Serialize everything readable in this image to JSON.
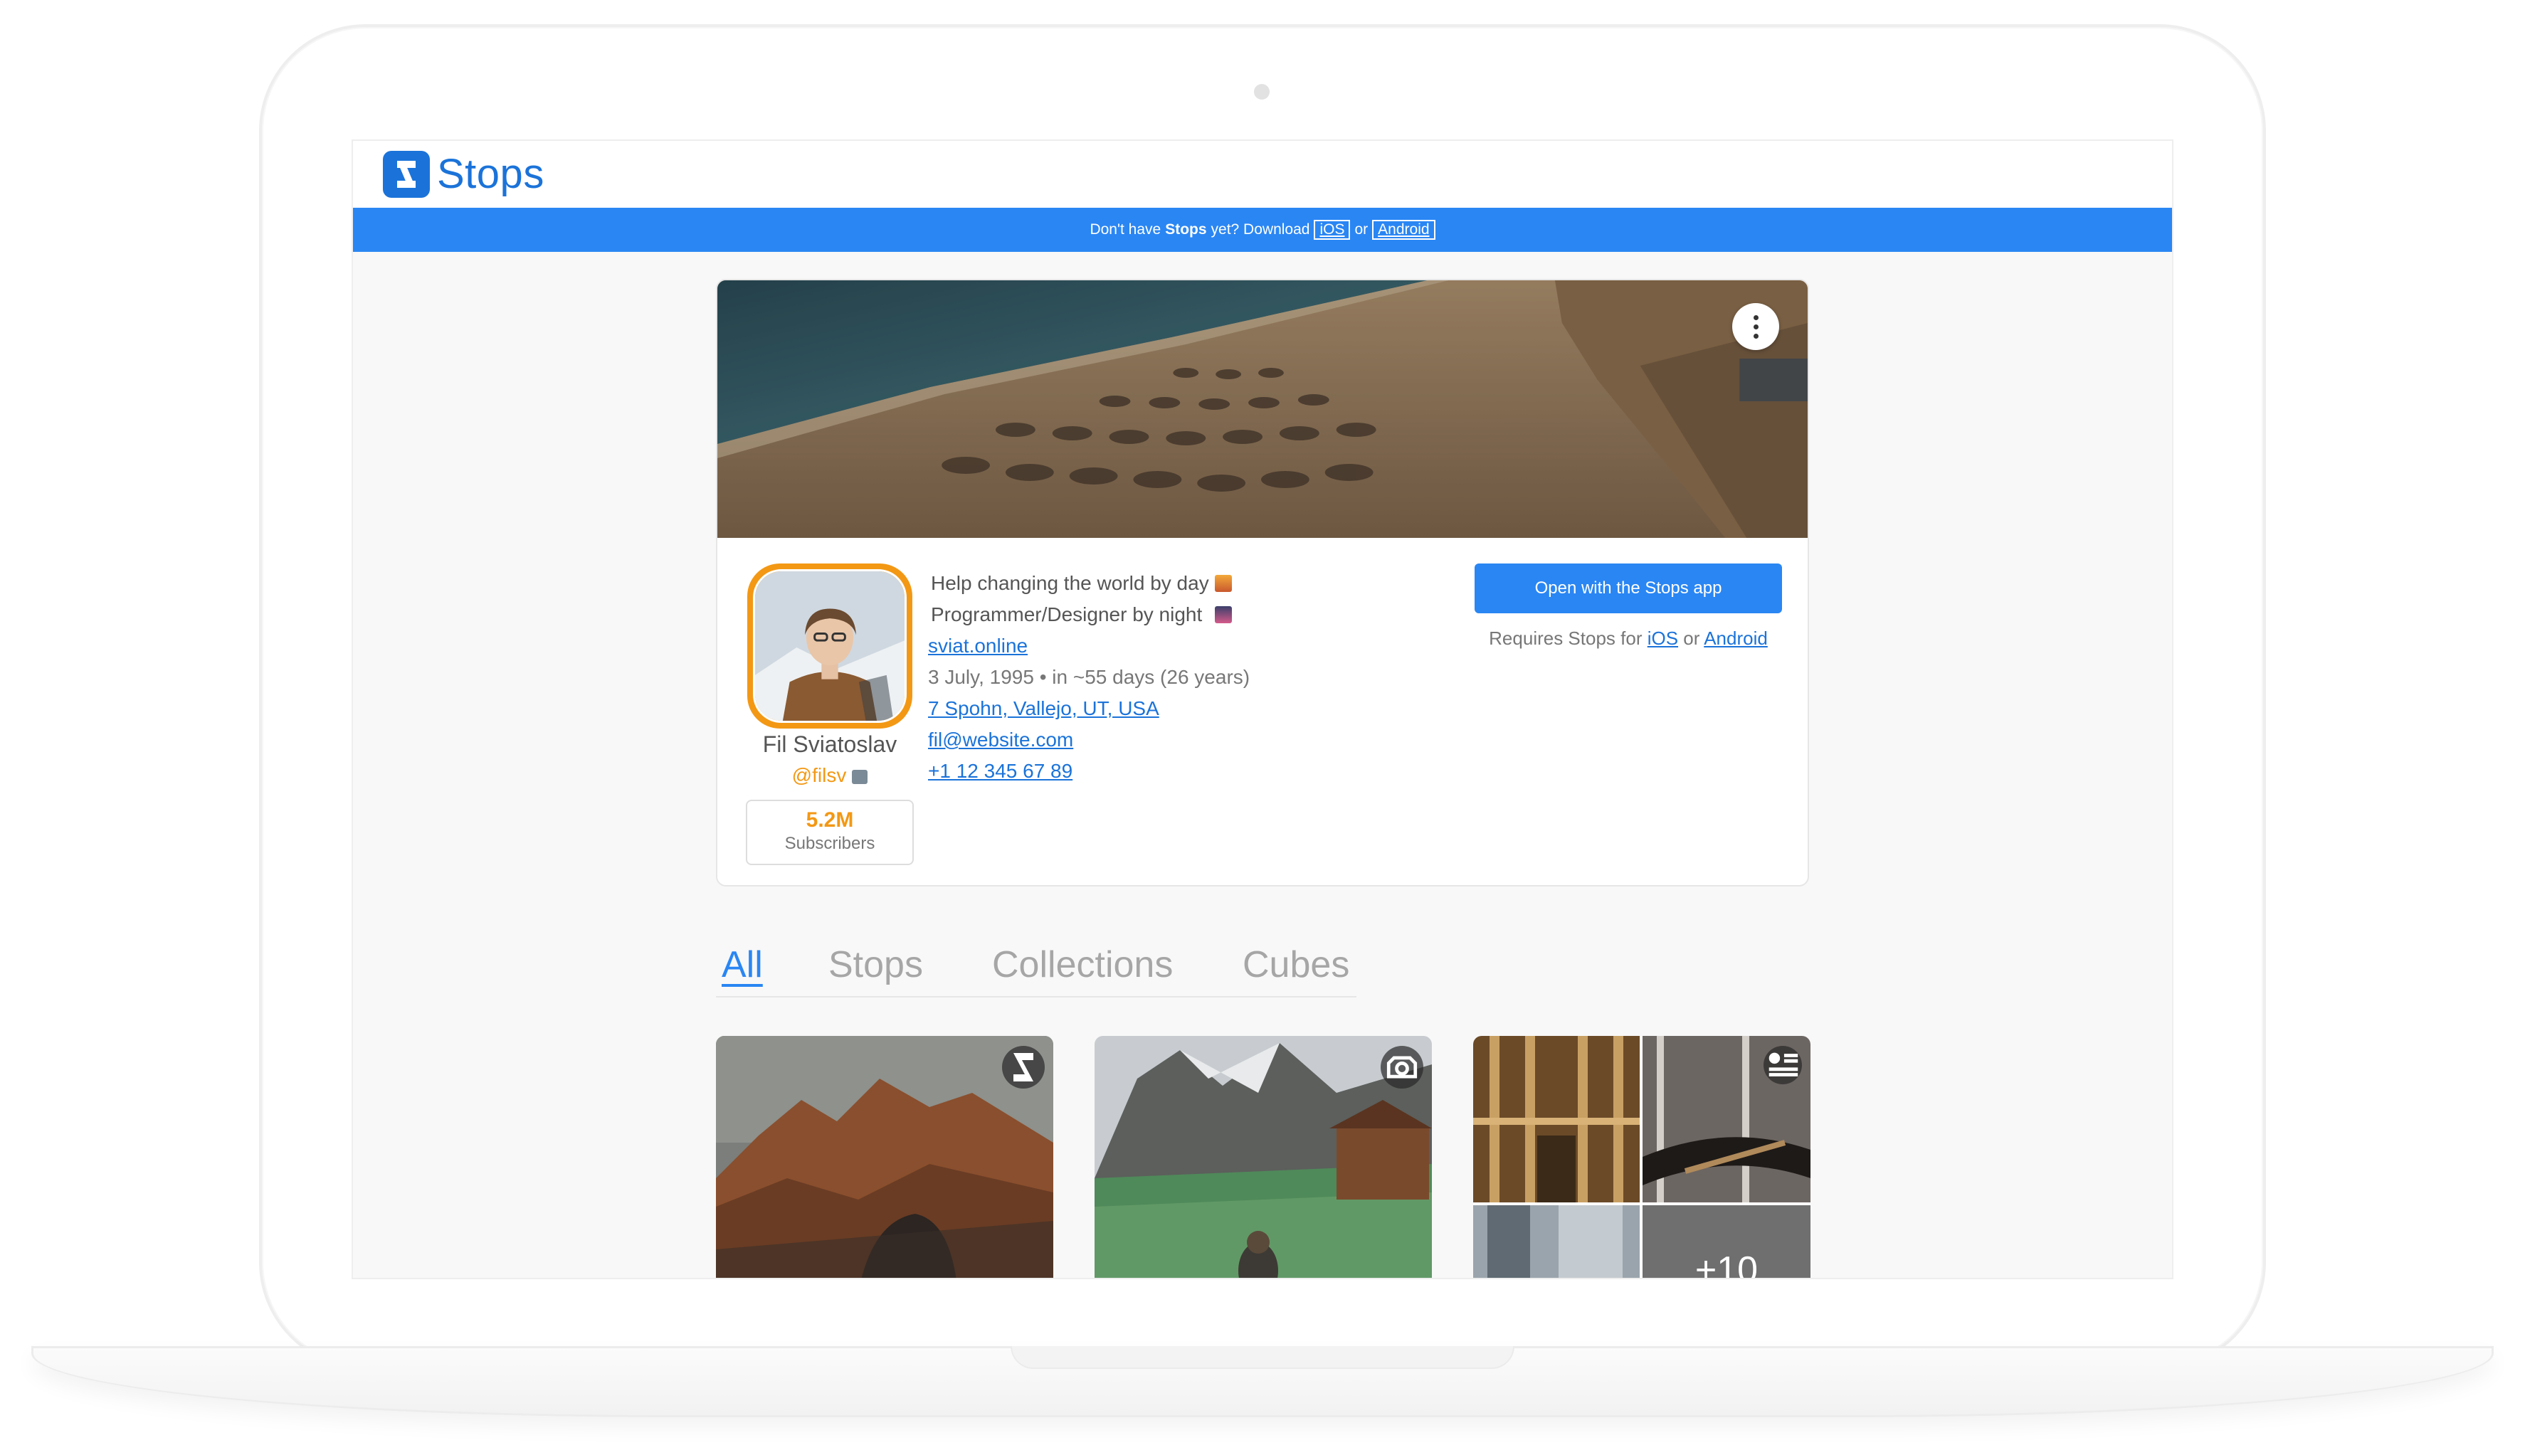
{
  "app": {
    "name": "Stops"
  },
  "banner": {
    "prefix": "Don't have",
    "brand": "Stops",
    "middle": "yet? Download",
    "ios": "iOS",
    "or": "or",
    "android": "Android"
  },
  "profile": {
    "name": "Fil Sviatoslav",
    "handle": "@filsv",
    "subscribers_count": "5.2M",
    "subscribers_label": "Subscribers",
    "bio_line1": "Help changing the world by day",
    "bio_line2": "Programmer/Designer by night",
    "website": "sviat.online",
    "birthday": "3 July, 1995 • in ~55 days (26 years)",
    "address": "7 Spohn, Vallejo, UT, USA",
    "email": "fil@website.com",
    "phone": "+1 12 345 67 89"
  },
  "actions": {
    "open_button": "Open with the Stops app",
    "requires_prefix": "Requires Stops for",
    "ios": "iOS",
    "or": "or",
    "android": "Android"
  },
  "tabs": [
    {
      "label": "All",
      "active": true
    },
    {
      "label": "Stops",
      "active": false
    },
    {
      "label": "Collections",
      "active": false
    },
    {
      "label": "Cubes",
      "active": false
    }
  ],
  "grid": {
    "collage_more": "+10"
  },
  "colors": {
    "accent": "#2a86f3",
    "brand": "#1b73d9",
    "highlight": "#f39814"
  },
  "icons": [
    "stops-logo-icon",
    "more-vertical-icon",
    "stops-badge-icon",
    "camera-badge-icon",
    "collection-badge-icon"
  ]
}
